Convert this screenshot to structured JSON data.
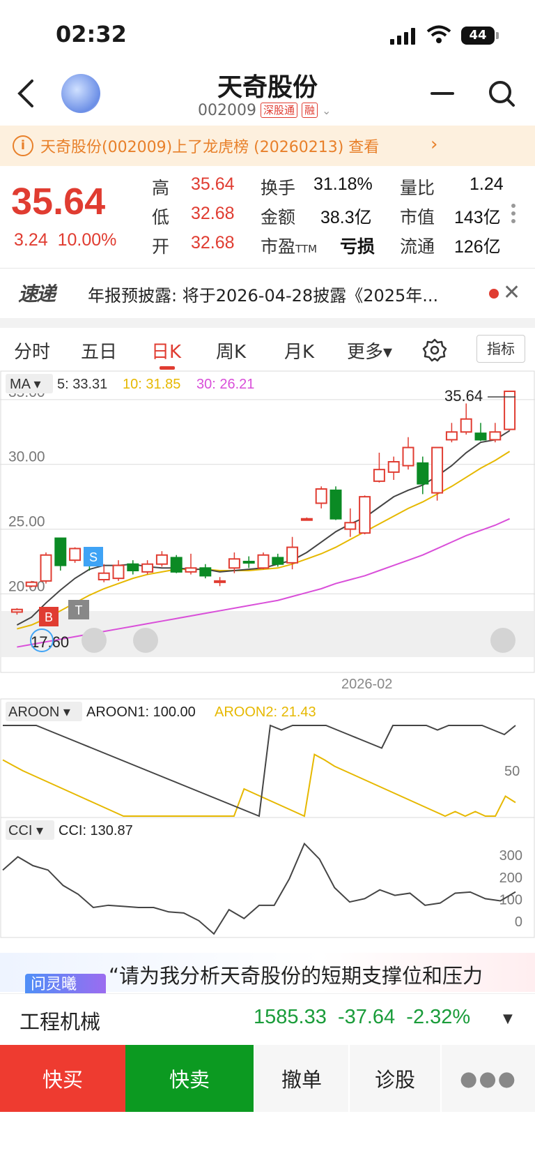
{
  "status": {
    "time": "02:32",
    "battery": "44"
  },
  "header": {
    "title": "天奇股份",
    "code": "002009",
    "tag1": "深股通",
    "tag2": "融"
  },
  "banner": {
    "text": "天奇股份(002009)上了龙虎榜 (20260213)  查看"
  },
  "quote": {
    "price": "35.64",
    "change": "3.24",
    "change_pct": "10.00%",
    "high_label": "高",
    "high": "35.64",
    "low_label": "低",
    "low": "32.68",
    "open_label": "开",
    "open": "32.68",
    "turnover_label": "换手",
    "turnover": "31.18%",
    "amount_label": "金额",
    "amount": "38.3亿",
    "pe_label": "市盈",
    "pe_sub": "TTM",
    "pe": "亏损",
    "volratio_label": "量比",
    "volratio": "1.24",
    "mcap_label": "市值",
    "mcap": "143亿",
    "float_label": "流通",
    "float": "126亿"
  },
  "news": {
    "logo": "速递",
    "text": "年报预披露: 将于2026-04-28披露《2025年..."
  },
  "tabs": [
    "分时",
    "五日",
    "日K",
    "周K",
    "月K",
    "更多▾"
  ],
  "index_button": "指标",
  "chart_data": [
    {
      "type": "candlestick",
      "indicator": "MA",
      "legend": {
        "ma5": "5: 33.31",
        "ma10": "10: 31.85",
        "ma30": "30: 26.21"
      },
      "y_ticks": [
        "35.00",
        "30.00",
        "25.00",
        "20.00"
      ],
      "ylim": [
        15.5,
        36.5
      ],
      "x_label": "2026-02",
      "max_label": "35.64",
      "min_label": "17.60",
      "markers": [
        "B",
        "S",
        "T"
      ],
      "candles": [
        {
          "o": 18.6,
          "c": 18.8,
          "h": 18.9,
          "l": 18.4
        },
        {
          "o": 20.6,
          "c": 20.9,
          "h": 21.0,
          "l": 20.5
        },
        {
          "o": 21.0,
          "c": 23.0,
          "h": 23.2,
          "l": 20.8
        },
        {
          "o": 24.3,
          "c": 22.2,
          "h": 24.3,
          "l": 21.8
        },
        {
          "o": 22.6,
          "c": 23.5,
          "h": 23.6,
          "l": 22.4
        },
        {
          "o": 23.1,
          "c": 22.2,
          "h": 23.6,
          "l": 21.8
        },
        {
          "o": 21.1,
          "c": 21.6,
          "h": 22.3,
          "l": 20.9
        },
        {
          "o": 21.2,
          "c": 22.2,
          "h": 22.6,
          "l": 21.0
        },
        {
          "o": 22.3,
          "c": 21.8,
          "h": 22.6,
          "l": 21.5
        },
        {
          "o": 21.7,
          "c": 22.3,
          "h": 22.6,
          "l": 21.5
        },
        {
          "o": 22.3,
          "c": 23.0,
          "h": 23.3,
          "l": 22.1
        },
        {
          "o": 22.8,
          "c": 21.7,
          "h": 23.0,
          "l": 21.6
        },
        {
          "o": 21.7,
          "c": 22.0,
          "h": 23.1,
          "l": 21.5
        },
        {
          "o": 22.0,
          "c": 21.4,
          "h": 22.3,
          "l": 21.2
        },
        {
          "o": 21.0,
          "c": 21.0,
          "h": 21.3,
          "l": 20.6
        },
        {
          "o": 22.0,
          "c": 22.7,
          "h": 23.2,
          "l": 21.6
        },
        {
          "o": 22.5,
          "c": 22.4,
          "h": 22.9,
          "l": 22.0
        },
        {
          "o": 22.0,
          "c": 23.0,
          "h": 23.2,
          "l": 21.9
        },
        {
          "o": 22.8,
          "c": 22.3,
          "h": 23.1,
          "l": 22.1
        },
        {
          "o": 22.4,
          "c": 23.6,
          "h": 24.4,
          "l": 21.9
        },
        {
          "o": 25.8,
          "c": 25.8,
          "h": 25.9,
          "l": 25.7
        },
        {
          "o": 27.0,
          "c": 28.1,
          "h": 28.3,
          "l": 26.6
        },
        {
          "o": 28.0,
          "c": 25.8,
          "h": 28.3,
          "l": 25.7
        },
        {
          "o": 25.0,
          "c": 25.5,
          "h": 26.6,
          "l": 24.4
        },
        {
          "o": 24.7,
          "c": 27.5,
          "h": 27.6,
          "l": 24.6
        },
        {
          "o": 28.7,
          "c": 29.6,
          "h": 30.9,
          "l": 28.6
        },
        {
          "o": 29.4,
          "c": 30.2,
          "h": 30.6,
          "l": 28.8
        },
        {
          "o": 29.9,
          "c": 31.3,
          "h": 32.1,
          "l": 29.6
        },
        {
          "o": 30.1,
          "c": 28.5,
          "h": 30.6,
          "l": 27.7
        },
        {
          "o": 27.8,
          "c": 31.3,
          "h": 31.3,
          "l": 27.2
        },
        {
          "o": 31.9,
          "c": 32.5,
          "h": 33.2,
          "l": 31.7
        },
        {
          "o": 32.5,
          "c": 33.5,
          "h": 34.7,
          "l": 32.3
        },
        {
          "o": 32.4,
          "c": 31.9,
          "h": 33.2,
          "l": 31.8
        },
        {
          "o": 31.9,
          "c": 32.5,
          "h": 33.2,
          "l": 31.7
        },
        {
          "o": 32.7,
          "c": 35.64,
          "h": 35.64,
          "l": 32.6
        }
      ],
      "ma5": [
        17.6,
        18.2,
        19.3,
        20.3,
        21.2,
        21.9,
        22.2,
        22.2,
        22.3,
        22.1,
        22.0,
        22.0,
        21.9,
        21.9,
        21.7,
        21.8,
        21.9,
        22.0,
        22.3,
        22.6,
        23.2,
        24.0,
        24.8,
        25.4,
        25.9,
        26.7,
        27.5,
        28.0,
        28.4,
        29.1,
        29.9,
        30.9,
        31.7,
        31.9,
        32.6
      ],
      "ma10": [
        17.3,
        17.6,
        18.1,
        18.7,
        19.3,
        19.9,
        20.4,
        20.8,
        21.2,
        21.5,
        21.7,
        21.9,
        21.9,
        21.9,
        21.8,
        21.8,
        21.8,
        21.9,
        22.0,
        22.3,
        22.7,
        23.1,
        23.6,
        24.2,
        24.8,
        25.4,
        26.0,
        26.6,
        27.1,
        27.7,
        28.3,
        29.0,
        29.7,
        30.3,
        31.0
      ],
      "ma30": [
        15.9,
        16.1,
        16.3,
        16.5,
        16.7,
        16.9,
        17.1,
        17.3,
        17.5,
        17.7,
        17.9,
        18.1,
        18.3,
        18.5,
        18.7,
        18.9,
        19.1,
        19.3,
        19.5,
        19.8,
        20.1,
        20.4,
        20.8,
        21.1,
        21.4,
        21.8,
        22.2,
        22.6,
        23.0,
        23.5,
        24.0,
        24.5,
        24.9,
        25.3,
        25.8
      ]
    },
    {
      "type": "line",
      "indicator": "AROON",
      "legend": {
        "aroon1": "AROON1: 100.00",
        "aroon2": "AROON2: 21.43"
      },
      "y_ticks": [
        "50"
      ],
      "ylim": [
        0,
        100
      ],
      "aroon1": [
        100,
        100,
        100,
        100,
        95,
        90,
        85,
        80,
        75,
        70,
        65,
        60,
        55,
        50,
        45,
        40,
        35,
        30,
        25,
        20,
        15,
        10,
        5,
        0,
        100,
        95,
        100,
        100,
        100,
        100,
        95,
        90,
        85,
        80,
        75,
        100,
        100,
        100,
        100,
        95,
        100,
        100,
        100,
        100,
        95,
        90,
        100
      ],
      "aroon2": [
        62,
        56,
        50,
        45,
        40,
        35,
        30,
        25,
        20,
        15,
        10,
        5,
        0,
        0,
        0,
        0,
        0,
        0,
        0,
        0,
        0,
        0,
        0,
        0,
        30,
        25,
        20,
        15,
        10,
        5,
        0,
        68,
        62,
        55,
        50,
        45,
        40,
        35,
        30,
        25,
        20,
        15,
        10,
        5,
        0,
        5,
        0,
        5,
        0,
        0,
        22,
        15
      ]
    },
    {
      "type": "line",
      "indicator": "CCI",
      "legend": {
        "cci": "CCI: 130.87"
      },
      "y_ticks": [
        "300",
        "200",
        "100",
        "0"
      ],
      "ylim": [
        -70,
        380
      ],
      "values": [
        230,
        290,
        250,
        230,
        160,
        120,
        60,
        70,
        65,
        60,
        60,
        40,
        35,
        0,
        -60,
        50,
        10,
        70,
        70,
        190,
        350,
        280,
        150,
        85,
        100,
        140,
        115,
        125,
        70,
        80,
        125,
        130,
        100,
        90,
        130.87
      ]
    }
  ]
}
